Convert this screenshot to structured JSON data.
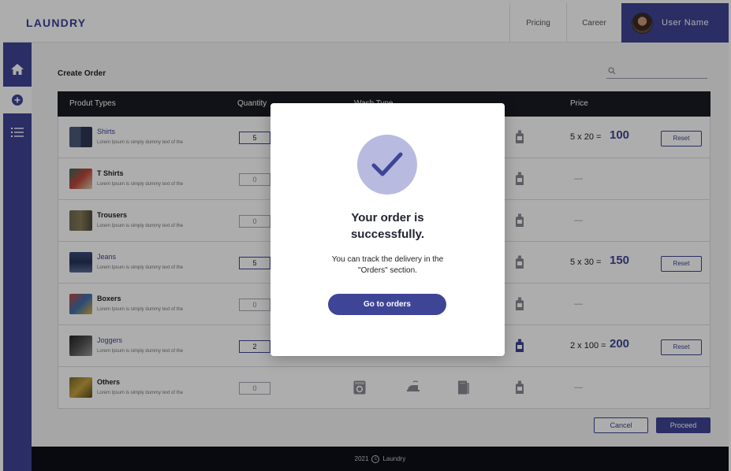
{
  "header": {
    "brand": "LAUNDRY",
    "nav": [
      {
        "label": "Pricing"
      },
      {
        "label": "Career"
      }
    ],
    "user_name": "User Name"
  },
  "sidebar": {
    "items": [
      {
        "icon": "home-icon"
      },
      {
        "icon": "add-circle-icon",
        "active": true
      },
      {
        "icon": "list-icon"
      }
    ]
  },
  "main": {
    "title": "Create Order",
    "search": {
      "placeholder": ""
    },
    "columns": [
      "Produt Types",
      "Quantity",
      "Wash Type",
      "Price"
    ],
    "rows": [
      {
        "name": "Shirts",
        "description": "Lorem Ipsum is simply dummy text of the",
        "quantity": "5",
        "selected": true,
        "price": "5 x 20 =",
        "total": "100",
        "reset": "Reset"
      },
      {
        "name": "T Shirts",
        "description": "Lorem Ipsum is simply dummy text of the",
        "quantity": "0",
        "selected": false,
        "dash": "—"
      },
      {
        "name": "Trousers",
        "description": "Lorem Ipsum is simply dummy text of the",
        "quantity": "0",
        "selected": false,
        "dash": "—"
      },
      {
        "name": "Jeans",
        "description": "Lorem Ipsum is simply dummy text of the",
        "quantity": "5",
        "selected": true,
        "price": "5 x 30 =",
        "total": "150",
        "reset": "Reset"
      },
      {
        "name": "Boxers",
        "description": "Lorem Ipsum is simply dummy text of the",
        "quantity": "0",
        "selected": false,
        "dash": "—"
      },
      {
        "name": "Joggers",
        "description": "Lorem Ipsum is simply dummy text of the",
        "quantity": "2",
        "selected": true,
        "price": "2 x 100 =",
        "total": "200",
        "reset": "Reset"
      },
      {
        "name": "Others",
        "description": "Lorem Ipsum is simply dummy text of the",
        "quantity": "0",
        "selected": false,
        "dash": "—"
      }
    ],
    "cancel_label": "Cancel",
    "proceed_label": "Proceed"
  },
  "footer": {
    "year": "2021",
    "copyright_symbol": "c",
    "brand": "Laundry"
  },
  "modal": {
    "title_line1": "Your order is",
    "title_line2": "successfully.",
    "text_line1": "You can track the delivery in the",
    "text_line2": "\"Orders\" section.",
    "button_label": "Go to orders"
  },
  "colors": {
    "primary": "#3f4596",
    "dark": "#1a1b22",
    "check_bg": "#b8bae0"
  }
}
